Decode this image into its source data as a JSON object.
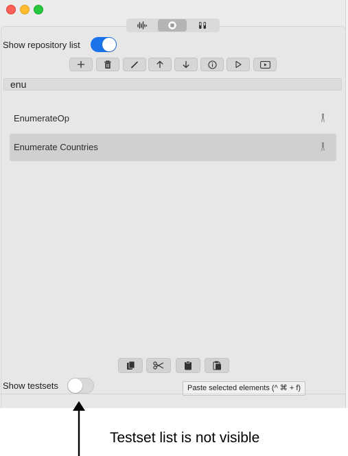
{
  "window": {
    "traffic_lights": [
      "close",
      "minimize",
      "zoom"
    ],
    "segments": [
      {
        "icon": "waveform-icon",
        "active": false
      },
      {
        "icon": "database-icon",
        "active": true
      },
      {
        "icon": "test-tubes-icon",
        "active": false
      }
    ]
  },
  "repository": {
    "toggle_label": "Show repository list",
    "toggle_on": true,
    "toolbar": [
      {
        "name": "add-button",
        "icon": "plus-icon"
      },
      {
        "name": "delete-button",
        "icon": "trash-icon"
      },
      {
        "name": "edit-button",
        "icon": "pencil-icon"
      },
      {
        "name": "move-up-button",
        "icon": "arrow-up-icon"
      },
      {
        "name": "move-down-button",
        "icon": "arrow-down-icon"
      },
      {
        "name": "info-button",
        "icon": "info-icon"
      },
      {
        "name": "run-button",
        "icon": "play-icon"
      },
      {
        "name": "present-button",
        "icon": "play-rectangle-icon"
      }
    ],
    "search_value": "enu",
    "items": [
      {
        "label": "EnumerateOp",
        "selected": false
      },
      {
        "label": "Enumerate Countries",
        "selected": true
      }
    ]
  },
  "bottom_toolbar": [
    {
      "name": "copy-button",
      "icon": "copy-icon"
    },
    {
      "name": "cut-button",
      "icon": "scissors-icon"
    },
    {
      "name": "paste-button",
      "icon": "paste-icon"
    },
    {
      "name": "paste-special-button",
      "icon": "paste-special-icon"
    }
  ],
  "testsets": {
    "toggle_label": "Show testsets",
    "toggle_on": false
  },
  "tooltip": "Paste selected elements (^ ⌘ + f)",
  "annotation": "Testset list is not visible"
}
